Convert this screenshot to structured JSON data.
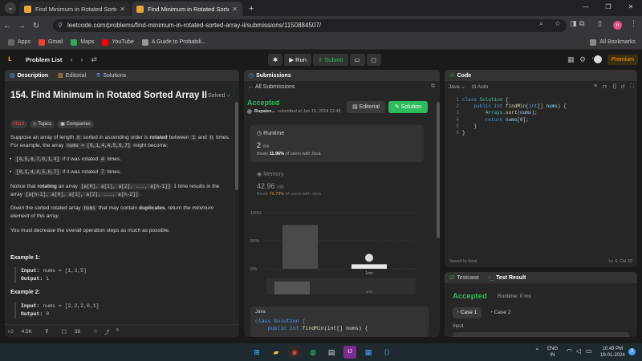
{
  "browser": {
    "tabs": [
      {
        "title": "Find Minimum in Rotated Sorte",
        "active": false
      },
      {
        "title": "Find Minimum in Rotated Sorte",
        "active": true
      }
    ],
    "url": "leetcode.com/problems/find-minimum-in-rotated-sorted-array-ii/submissions/1150884507/",
    "bookmarks": [
      "Apps",
      "Gmail",
      "Maps",
      "YouTube",
      "A Guide to Probabili..."
    ],
    "all_bookmarks": "All Bookmarks",
    "profile_initial": "n"
  },
  "lc_header": {
    "problem_list": "Problem List",
    "run": "Run",
    "submit": "Submit",
    "streak": "1",
    "premium": "Premium"
  },
  "description": {
    "tabs": [
      "Description",
      "Editorial",
      "Solutions"
    ],
    "title": "154. Find Minimum in Rotated Sorted Array II",
    "solved": "Solved",
    "chips": [
      "Hard",
      "Topics",
      "Companies"
    ],
    "p1a": "Suppose an array of length",
    "p1_n": "n",
    "p1b": "sorted in ascending order is",
    "p1_rotated": "rotated",
    "p1c": "between",
    "p1_one": "1",
    "p1d": "and",
    "p1_n2": "n",
    "p1e": "times.",
    "p1f": "For example, the array",
    "p1_nums": "nums = [0,1,4,4,5,6,7]",
    "p1g": "might become:",
    "bullet1_code": "[4,5,6,7,0,1,4]",
    "bullet1_a": "if it was rotated",
    "bullet1_n": "4",
    "bullet1_b": "times.",
    "bullet2_code": "[0,1,4,4,5,6,7]",
    "bullet2_a": "if it was rotated",
    "bullet2_n": "7",
    "bullet2_b": "times.",
    "p2a": "Notice that",
    "p2_rotating": "rotating",
    "p2b": "an array",
    "p2_arr": "[a[0], a[1], a[2], ..., a[n-1]]",
    "p2c": "1 time results in the",
    "p2d": "array",
    "p2_arr2": "[a[n-1], a[0], a[1], a[2], ..., a[n-2]]",
    "p2e": ".",
    "p3a": "Given the sorted rotated array",
    "p3_nums": "nums",
    "p3b": "that may contain",
    "p3_dup": "duplicates",
    "p3c": ", return",
    "p3_ital": "the minimum element of this array",
    "p3d": ".",
    "p4": "You must decrease the overall operation steps as much as possible.",
    "ex1_title": "Example 1:",
    "ex1_input_label": "Input:",
    "ex1_input": "nums = [1,3,5]",
    "ex1_output_label": "Output:",
    "ex1_output": "1",
    "ex2_title": "Example 2:",
    "ex2_input_label": "Input:",
    "ex2_input": "nums = [2,2,2,0,1]",
    "ex2_output_label": "Output:",
    "ex2_output": "0",
    "footer": {
      "likes": "4.5K",
      "comments": "38"
    }
  },
  "submissions": {
    "header": "Submissions",
    "back": "All Submissions",
    "status": "Accepted",
    "user": "Rupalee...",
    "submitted": "submitted at Jan 19, 2024 22:48",
    "editorial_btn": "Editorial",
    "solution_btn": "Solution",
    "runtime_label": "Runtime",
    "runtime_value": "2",
    "runtime_unit": "ms",
    "runtime_beats_a": "Beats",
    "runtime_beats_pct": "11.96%",
    "runtime_beats_b": "of users with Java",
    "memory_label": "Memory",
    "memory_value": "42.96",
    "memory_unit": "MB",
    "memory_beats_a": "Beats",
    "memory_beats_pct": "76.79%",
    "memory_beats_b": "of users with Java",
    "chart_ticks": [
      "100%",
      "50%",
      "0%"
    ],
    "chart_marker": "1ms",
    "chart_marker2": "1ms",
    "code_lang": "Java",
    "code_line1": "class Solution {",
    "code_line2a": "    public int",
    "code_line2b": "findMin",
    "code_line2c": "(int[] nums) {"
  },
  "chart_data": {
    "type": "bar",
    "categories": [
      "",
      "1ms"
    ],
    "values": [
      78,
      8
    ],
    "ylim": [
      0,
      100
    ],
    "title": "",
    "xlabel": "",
    "ylabel": ""
  },
  "editor": {
    "header": "Code",
    "lang": "Java",
    "mode": "Auto",
    "lines": [
      {
        "n": "1",
        "tokens": [
          {
            "c": "kw",
            "t": "class "
          },
          {
            "c": "ty",
            "t": "Solution"
          },
          {
            "c": "",
            "t": " {"
          }
        ]
      },
      {
        "n": "2",
        "tokens": [
          {
            "c": "kw",
            "t": "    public int "
          },
          {
            "c": "fn",
            "t": "findMin"
          },
          {
            "c": "",
            "t": "("
          },
          {
            "c": "kw",
            "t": "int"
          },
          {
            "c": "",
            "t": "[] "
          },
          {
            "c": "vr",
            "t": "nums"
          },
          {
            "c": "",
            "t": ") {"
          }
        ]
      },
      {
        "n": "3",
        "tokens": [
          {
            "c": "ty",
            "t": "        Arrays"
          },
          {
            "c": "",
            "t": "."
          },
          {
            "c": "fn",
            "t": "sort"
          },
          {
            "c": "",
            "t": "("
          },
          {
            "c": "vr",
            "t": "nums"
          },
          {
            "c": "",
            "t": ");"
          }
        ]
      },
      {
        "n": "4",
        "tokens": [
          {
            "c": "kw",
            "t": "        return "
          },
          {
            "c": "vr",
            "t": "nums"
          },
          {
            "c": "",
            "t": "[0];"
          }
        ]
      },
      {
        "n": "5",
        "tokens": [
          {
            "c": "",
            "t": "    }"
          }
        ]
      },
      {
        "n": "6",
        "tokens": [
          {
            "c": "",
            "t": "}"
          }
        ]
      }
    ],
    "saved": "Saved to local",
    "cursor": "Ln 4, Col 20"
  },
  "testpanel": {
    "tab1": "Testcase",
    "tab2": "Test Result",
    "status": "Accepted",
    "runtime": "Runtime: 0 ms",
    "case1": "Case 1",
    "case2": "Case 2",
    "input_label": "Input"
  },
  "taskbar": {
    "lang_top": "ENG",
    "lang_bottom": "IN",
    "time": "10:49 PM",
    "date": "19-01-2024",
    "notif": "3"
  },
  "colors": {
    "accent_green": "#2cbb5d",
    "hard_red": "#ef4743",
    "premium_orange": "#ffa116"
  }
}
